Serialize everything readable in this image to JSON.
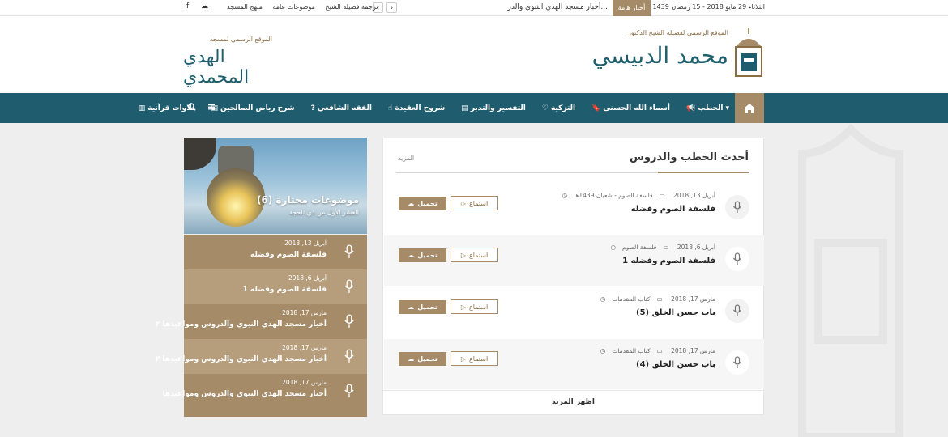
{
  "topbar": {
    "date": "الثلاثاء 29 مايو 2018 - 15 رمضان 1439 هـ",
    "breaking_label": "أخبار هامة",
    "ticker": "أخبار مسجد الهدي النبوي والدر...",
    "links": [
      "منهج المسجد",
      "موضوعات عامة",
      "ترجمة فضيلة الشيخ"
    ],
    "social_icons": [
      "facebook-icon",
      "soundcloud-icon"
    ]
  },
  "header": {
    "site_caption": "الموقع الرسمي لفضيلة الشيخ الدكتور",
    "site_name": "محمد الدبيسي",
    "mosque_caption": "الموقع الرسمي لمسجد",
    "mosque_name": "الهدي المحمدي"
  },
  "nav": {
    "items": [
      {
        "label": "الخطب",
        "icon": "bullhorn-icon"
      },
      {
        "label": "أسماء الله الحسنى",
        "icon": "bookmark-icon"
      },
      {
        "label": "التزكية",
        "icon": "heart-icon"
      },
      {
        "label": "التفسير والتدبر",
        "icon": "book-icon"
      },
      {
        "label": "شروح العقيدة",
        "icon": "hand-icon"
      },
      {
        "label": "الفقه الشافعي",
        "icon": "question-icon"
      },
      {
        "label": "شرح رياض الصالحين",
        "icon": "book-icon"
      },
      {
        "label": "تلاوات قرآنية",
        "icon": "book-open-icon"
      }
    ]
  },
  "main": {
    "title": "أحدث الخطب والدروس",
    "more": "المزيد",
    "listen_label": "استماع",
    "download_label": "تحميل",
    "show_more": "اظهر المزيد",
    "lessons": [
      {
        "date": "أبريل 13, 2018",
        "category": "فلسفة الصوم - شعبان 1439هـ",
        "title": "فلسفة الصوم وفضله"
      },
      {
        "date": "أبريل 6, 2018",
        "category": "فلسفة الصوم",
        "title": "فلسفة الصوم وفضله 1"
      },
      {
        "date": "مارس 17, 2018",
        "category": "كتاب المقدمات",
        "title": "باب حسن الخلق (5)"
      },
      {
        "date": "مارس 17, 2018",
        "category": "كتاب المقدمات",
        "title": "باب حسن الخلق (4)"
      }
    ]
  },
  "sidebar": {
    "featured_title": "موضوعات مختارة (6)",
    "featured_sub": "العشر الأول من ذي الحجة",
    "items": [
      {
        "date": "أبريل 13, 2018",
        "title": "فلسفة الصوم وفضله"
      },
      {
        "date": "أبريل 6, 2018",
        "title": "فلسفة الصوم وفضله 1"
      },
      {
        "date": "مارس 17, 2018",
        "title": "أخبار مسجد الهدي النبوي والدروس ومواعيدها ٢"
      },
      {
        "date": "مارس 17, 2018",
        "title": "أخبار مسجد الهدي النبوي والدروس ومواعيدها ٢"
      },
      {
        "date": "مارس 17, 2018",
        "title": "أخبار مسجد الهدي النبوي والدروس ومواعيدها"
      }
    ]
  },
  "colors": {
    "accent": "#a58b67",
    "nav": "#1f5c6d",
    "side_item_a": "#a58b67",
    "side_item_b": "#b69d7c"
  }
}
